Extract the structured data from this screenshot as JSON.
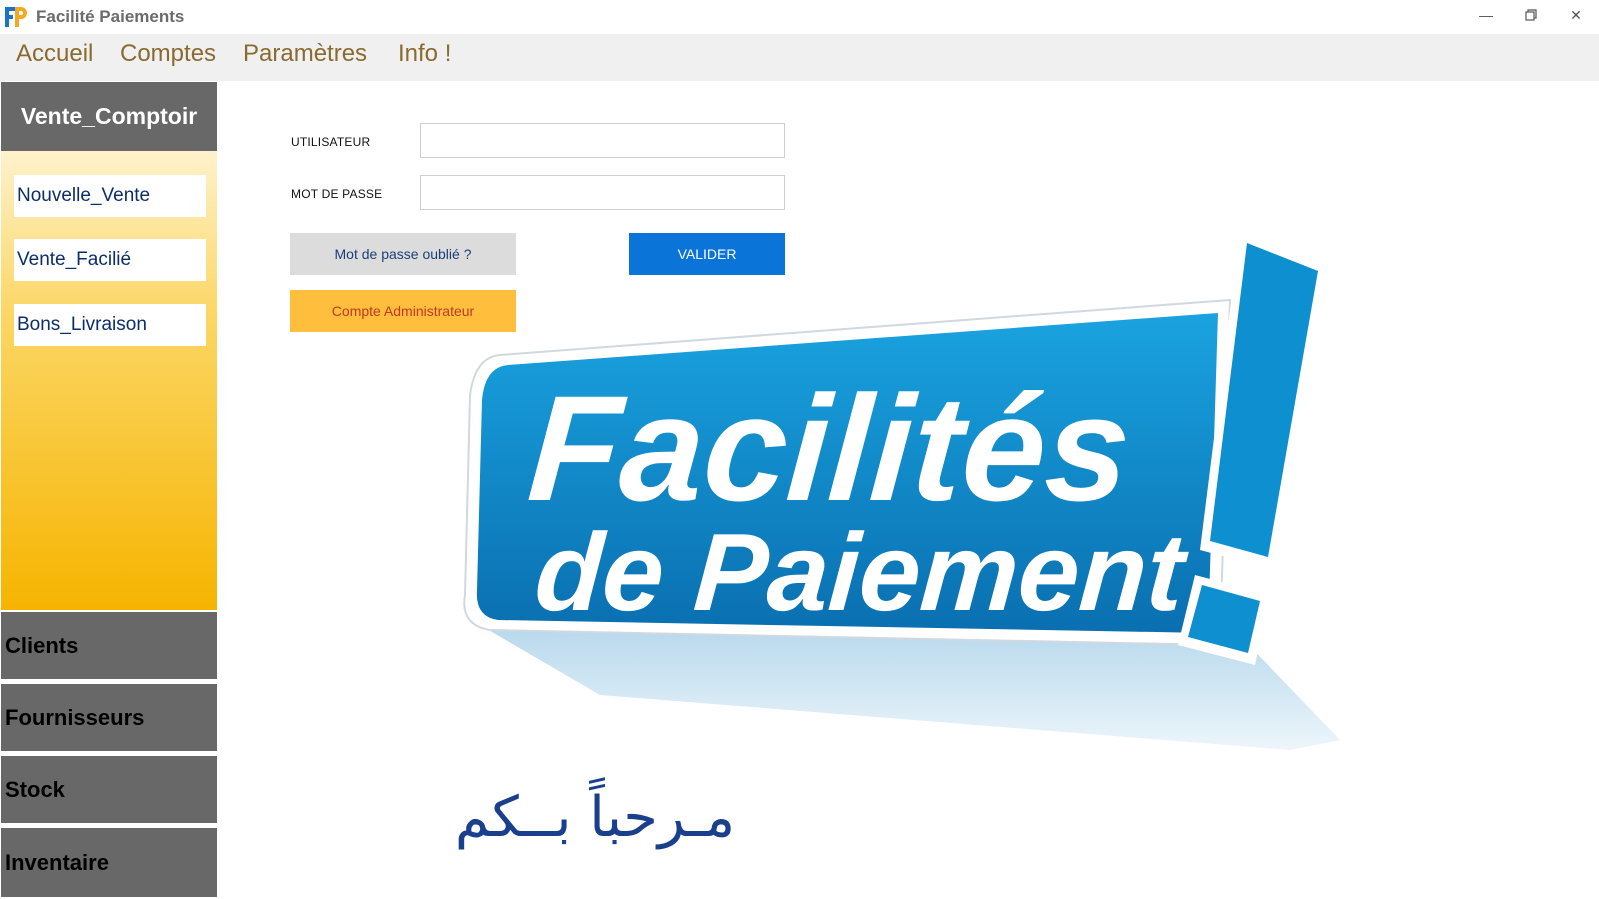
{
  "window": {
    "title": "Facilité Paiements",
    "controls": [
      "minimize",
      "restore",
      "close"
    ]
  },
  "menu": {
    "items": [
      "Accueil",
      "Comptes",
      "Paramètres",
      "Info !"
    ]
  },
  "sidebar": {
    "header": "Vente_Comptoir",
    "buttons": [
      "Nouvelle_Vente",
      "Vente_Facilié",
      "Bons_Livraison"
    ],
    "categories": [
      "Clients",
      "Fournisseurs",
      "Stock",
      "Inventaire"
    ]
  },
  "login": {
    "user_label": "UTILISATEUR",
    "user_value": "",
    "password_label": "MOT DE PASSE",
    "password_value": "",
    "forgot_label": "Mot de passe oublié ?",
    "validate_label": "VALIDER",
    "admin_label": "Compte Administrateur"
  },
  "banner": {
    "line1": "Facilités",
    "line2": "de Paiement",
    "mark": "!"
  },
  "welcome_text": "مـرحباً بــكم",
  "colors": {
    "accent_blue": "#0a74d8",
    "admin_orange": "#ffbe3b",
    "sidebar_gray": "#686868",
    "menu_text": "#8a6a2e",
    "banner_blue": "#0d8fd0"
  }
}
